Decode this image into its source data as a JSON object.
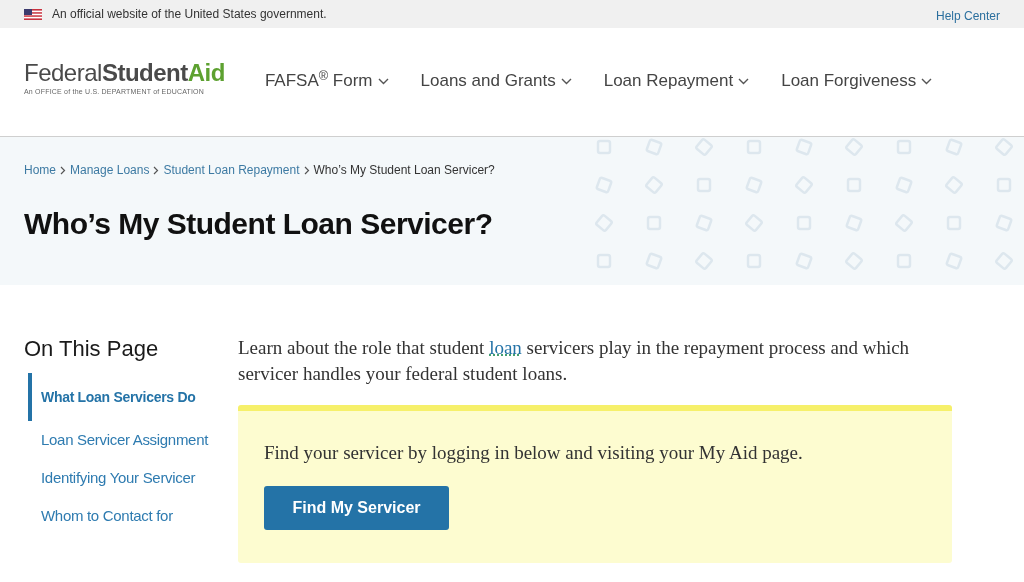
{
  "gov_banner": {
    "text": "An official website of the United States government.",
    "link": "Help Center"
  },
  "logo": {
    "word_1": "Federal",
    "word_2": "Student",
    "word_3": "Aid",
    "tagline": "An OFFICE of the U.S. DEPARTMENT of EDUCATION"
  },
  "nav": [
    {
      "label": "FAFSA$^{®}$ Form",
      "expanded": false
    },
    {
      "label": "Loans and Grants",
      "expanded": false
    },
    {
      "label": "Loan Repayment",
      "expanded": false
    },
    {
      "label": "Loan Forgiveness",
      "expanded": false
    }
  ],
  "breadcrumbs": [
    {
      "label": "Home",
      "current": false
    },
    {
      "label": "Manage Loans",
      "current": false
    },
    {
      "label": "Student Loan Repayment",
      "current": false
    },
    {
      "label": "Who’s My Student Loan Servicer?",
      "current": true
    }
  ],
  "page_title": "Who’s My Student Loan Servicer?",
  "sidebar": {
    "title": "On This Page",
    "items": [
      {
        "label": "What Loan Servicers Do",
        "selected": true
      },
      {
        "label": "Loan Servicer Assignment",
        "selected": false
      },
      {
        "label": "Identifying Your Servicer",
        "selected": false
      },
      {
        "label": "Whom to Contact for",
        "selected": false
      }
    ]
  },
  "intro": {
    "text_before": "Learn about the role that student",
    "term": "loan",
    "text_after": "servicers play in the repayment process and which servicer handles your federal student loans."
  },
  "callout": {
    "text": "Find your servicer by logging in below and visiting your My Aid page.",
    "button": "Find My Servicer"
  }
}
